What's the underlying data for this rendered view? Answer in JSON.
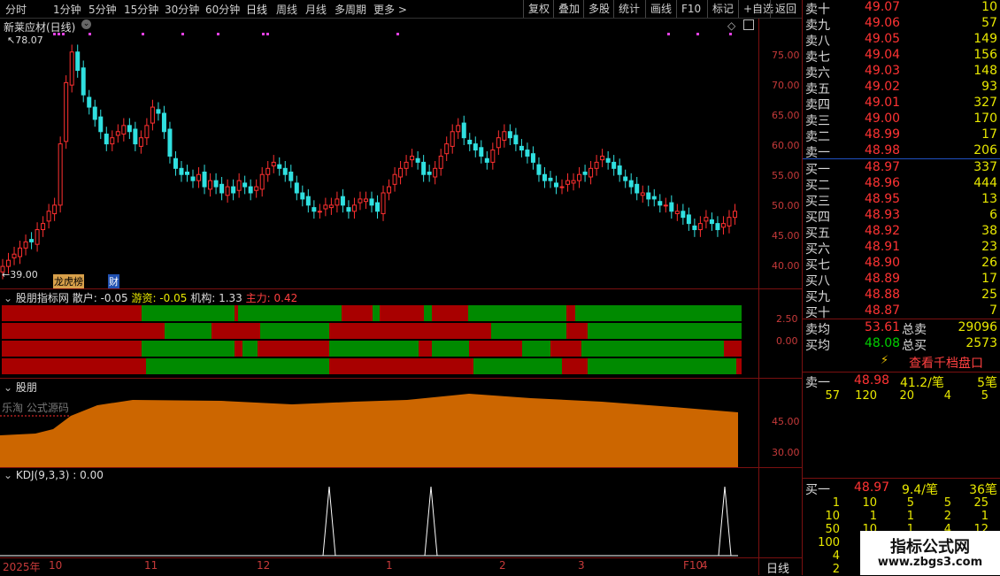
{
  "toolbar": {
    "periods": [
      "分时",
      "1分钟",
      "5分钟",
      "15分钟",
      "30分钟",
      "60分钟",
      "日线",
      "周线",
      "月线",
      "多周期",
      "更多 >"
    ],
    "active": "日线",
    "right_buttons": [
      "复权",
      "叠加",
      "多股",
      "统计",
      "画线",
      "F10",
      "标记",
      "+自选",
      "返回"
    ]
  },
  "main_chart": {
    "title": "新莱应材(日线)",
    "high_label": "78.07",
    "low_label": "39.00",
    "y_ticks": [
      "75.00",
      "70.00",
      "65.00",
      "60.00",
      "55.00",
      "50.00",
      "45.00",
      "40.00"
    ],
    "badges": [
      "龙虎榜",
      "财"
    ]
  },
  "indicator1": {
    "title": "股朋指标网",
    "values": "散户: -0.05",
    "youzi": "游资: -0.05",
    "jigou": "机构: 1.33",
    "zhuli": "主力: 0.42",
    "y_ticks": [
      "2.50",
      "0.00"
    ]
  },
  "indicator2": {
    "title": "股朋",
    "watermark": "乐淘 公式源码",
    "y_ticks": [
      "45.00",
      "30.00"
    ]
  },
  "indicator3": {
    "title": "KDJ(9,3,3)",
    "value": ": 0.00"
  },
  "x_axis": {
    "labels": [
      "2025年",
      "10",
      "11",
      "12",
      "1",
      "2",
      "3",
      "F10",
      "4"
    ],
    "period": "日线"
  },
  "order_book": {
    "sell": [
      {
        "label": "卖十",
        "price": "49.07",
        "vol": "10"
      },
      {
        "label": "卖九",
        "price": "49.06",
        "vol": "57"
      },
      {
        "label": "卖八",
        "price": "49.05",
        "vol": "149"
      },
      {
        "label": "卖七",
        "price": "49.04",
        "vol": "156"
      },
      {
        "label": "卖六",
        "price": "49.03",
        "vol": "148"
      },
      {
        "label": "卖五",
        "price": "49.02",
        "vol": "93"
      },
      {
        "label": "卖四",
        "price": "49.01",
        "vol": "327"
      },
      {
        "label": "卖三",
        "price": "49.00",
        "vol": "170"
      },
      {
        "label": "卖二",
        "price": "48.99",
        "vol": "17"
      },
      {
        "label": "卖一",
        "price": "48.98",
        "vol": "206"
      }
    ],
    "buy": [
      {
        "label": "买一",
        "price": "48.97",
        "vol": "337"
      },
      {
        "label": "买二",
        "price": "48.96",
        "vol": "444"
      },
      {
        "label": "买三",
        "price": "48.95",
        "vol": "13"
      },
      {
        "label": "买四",
        "price": "48.93",
        "vol": "6"
      },
      {
        "label": "买五",
        "price": "48.92",
        "vol": "38"
      },
      {
        "label": "买六",
        "price": "48.91",
        "vol": "23"
      },
      {
        "label": "买七",
        "price": "48.90",
        "vol": "26"
      },
      {
        "label": "买八",
        "price": "48.89",
        "vol": "17"
      },
      {
        "label": "买九",
        "price": "48.88",
        "vol": "25"
      },
      {
        "label": "买十",
        "price": "48.87",
        "vol": "7"
      }
    ],
    "sell_avg_label": "卖均",
    "sell_avg": "53.61",
    "total_sell_label": "总卖",
    "total_sell": "29096",
    "buy_avg_label": "买均",
    "buy_avg": "48.08",
    "total_buy_label": "总买",
    "total_buy": "2573",
    "view_button": "查看千档盘口",
    "sell1_label": "卖一",
    "sell1_price": "48.98",
    "sell1_avg": "41.2/笔",
    "sell1_count": "5笔",
    "sell1_queue": [
      "57",
      "120",
      "20",
      "4",
      "5"
    ],
    "buy1_label": "买一",
    "buy1_price": "48.97",
    "buy1_avg": "9.4/笔",
    "buy1_count": "36笔",
    "buy1_queue": [
      [
        "1",
        "10",
        "5",
        "5",
        "25"
      ],
      [
        "10",
        "1",
        "1",
        "2",
        "1"
      ],
      [
        "50",
        "10",
        "1",
        "4",
        "12"
      ],
      [
        "100"
      ],
      [
        "4"
      ],
      [
        "2"
      ]
    ]
  },
  "watermark": {
    "line1": "指标公式网",
    "line2": "www.zbgs3.com"
  }
}
